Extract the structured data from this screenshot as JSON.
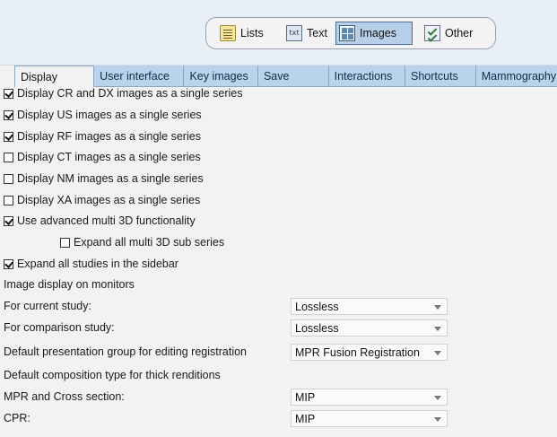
{
  "segments": [
    {
      "label": "Lists",
      "icon": "lists-icon",
      "active": false
    },
    {
      "label": "Text",
      "icon": "text-icon",
      "icon_text": "txt",
      "active": false
    },
    {
      "label": "Images",
      "icon": "images-icon",
      "active": true
    },
    {
      "label": "Other",
      "icon": "other-icon",
      "active": false
    }
  ],
  "tabs": [
    {
      "label": "Display",
      "active": true
    },
    {
      "label": "User interface"
    },
    {
      "label": "Key images"
    },
    {
      "label": "Save"
    },
    {
      "label": "Interactions"
    },
    {
      "label": "Shortcuts"
    },
    {
      "label": "Mammography"
    }
  ],
  "options": [
    {
      "label": "Display CR and DX images as a single series",
      "checked": true
    },
    {
      "label": "Display US images as a single series",
      "checked": true
    },
    {
      "label": "Display RF images as a single series",
      "checked": true
    },
    {
      "label": "Display CT images as a single series",
      "checked": false
    },
    {
      "label": "Display NM images as a single series",
      "checked": false
    },
    {
      "label": "Display XA images as a single series",
      "checked": false
    },
    {
      "label": "Use advanced multi 3D functionality",
      "checked": true
    },
    {
      "label": "Expand all multi 3D sub series",
      "checked": false
    },
    {
      "label": "Expand all studies in the sidebar",
      "checked": true
    }
  ],
  "section_monitors": "Image display on monitors",
  "current_study": {
    "label": "For current study:",
    "value": "Lossless"
  },
  "comparison_study": {
    "label": "For comparison study:",
    "value": "Lossless"
  },
  "presentation_group": {
    "label": "Default presentation group for editing registration",
    "value": "MPR Fusion Registration"
  },
  "section_thick": "Default composition type for thick renditions",
  "mpr_cross": {
    "label": "MPR and Cross section:",
    "value": "MIP"
  },
  "cpr": {
    "label": "CPR:",
    "value": "MIP"
  },
  "colors": {
    "tab_bar": "#b9d3ea",
    "header_bg": "#e9eff6",
    "active_segment": "#b8cfe8"
  }
}
